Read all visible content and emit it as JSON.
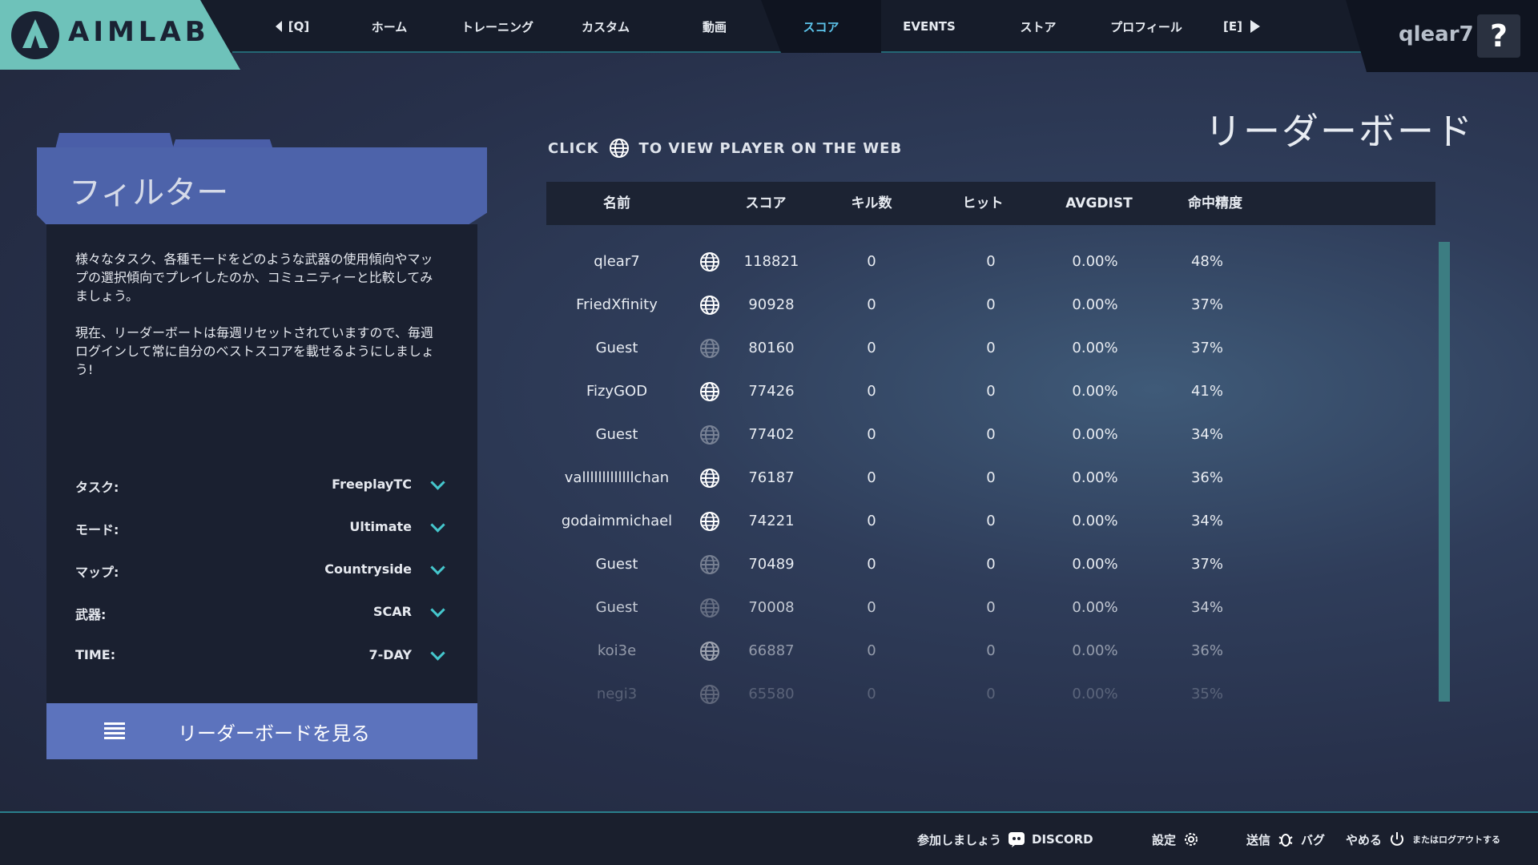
{
  "brand": {
    "name": "AIMLAB",
    "accent": "#6ec2ba"
  },
  "nav": {
    "prev_label": "[Q]",
    "items": [
      "ホーム",
      "トレーニング",
      "カスタム",
      "動画",
      "スコア",
      "EVENTS",
      "ストア",
      "プロフィール"
    ],
    "active_index": 4,
    "next_label": "[E]"
  },
  "user": {
    "name": "qlear7",
    "help": "?"
  },
  "filter": {
    "title": "フィルター",
    "desc1": "様々なタスク、各種モードをどのような武器の使用傾向やマップの選択傾向でプレイしたのか、コミュニティーと比較してみましょう。",
    "desc2": "現在、リーダーボートは毎週リセットされていますので、毎週ログインして常に自分のベストスコアを載せるようにしましょう!",
    "rows": [
      {
        "label": "タスク:",
        "value": "FreeplayTC"
      },
      {
        "label": "モード:",
        "value": "Ultimate"
      },
      {
        "label": "マップ:",
        "value": "Countryside"
      },
      {
        "label": "武器:",
        "value": "SCAR"
      },
      {
        "label": "TIME:",
        "value": "7-DAY"
      }
    ],
    "button": "リーダーボードを見る"
  },
  "leaderboard": {
    "title": "リーダーボード",
    "hint_before": "CLICK",
    "hint_after": "TO VIEW PLAYER ON THE WEB",
    "columns": [
      "名前",
      "スコア",
      "キル数",
      "ヒット",
      "AVGDIST",
      "命中精度"
    ],
    "rows": [
      {
        "name": "qlear7",
        "score": "118821",
        "kills": "0",
        "hits": "0",
        "avgdist": "0.00%",
        "accuracy": "48%"
      },
      {
        "name": "FriedXfinity",
        "score": "90928",
        "kills": "0",
        "hits": "0",
        "avgdist": "0.00%",
        "accuracy": "37%"
      },
      {
        "name": "Guest",
        "score": "80160",
        "kills": "0",
        "hits": "0",
        "avgdist": "0.00%",
        "accuracy": "37%"
      },
      {
        "name": "FizyGOD",
        "score": "77426",
        "kills": "0",
        "hits": "0",
        "avgdist": "0.00%",
        "accuracy": "41%"
      },
      {
        "name": "Guest",
        "score": "77402",
        "kills": "0",
        "hits": "0",
        "avgdist": "0.00%",
        "accuracy": "34%"
      },
      {
        "name": "valllllllllllllchan",
        "score": "76187",
        "kills": "0",
        "hits": "0",
        "avgdist": "0.00%",
        "accuracy": "36%"
      },
      {
        "name": "godaimmichael",
        "score": "74221",
        "kills": "0",
        "hits": "0",
        "avgdist": "0.00%",
        "accuracy": "34%"
      },
      {
        "name": "Guest",
        "score": "70489",
        "kills": "0",
        "hits": "0",
        "avgdist": "0.00%",
        "accuracy": "37%"
      },
      {
        "name": "Guest",
        "score": "70008",
        "kills": "0",
        "hits": "0",
        "avgdist": "0.00%",
        "accuracy": "34%"
      },
      {
        "name": "koi3e",
        "score": "66887",
        "kills": "0",
        "hits": "0",
        "avgdist": "0.00%",
        "accuracy": "36%"
      },
      {
        "name": "negi3",
        "score": "65580",
        "kills": "0",
        "hits": "0",
        "avgdist": "0.00%",
        "accuracy": "35%"
      }
    ]
  },
  "footer": {
    "join": "参加しましょう",
    "discord": "DISCORD",
    "settings": "設定",
    "send": "送信",
    "bug": "バグ",
    "quit": "やめる",
    "logout": "またはログアウトする"
  }
}
